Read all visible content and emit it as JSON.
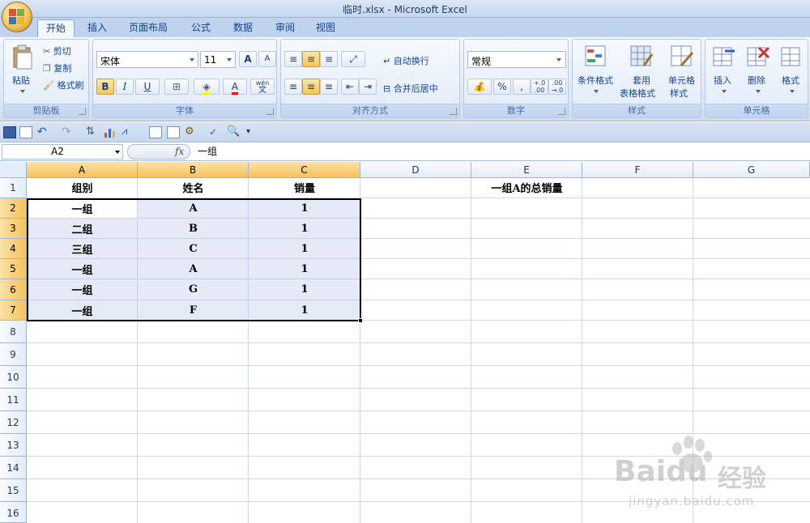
{
  "window": {
    "title": "临时.xlsx - Microsoft Excel"
  },
  "tabs": [
    {
      "label": "开始",
      "active": true
    },
    {
      "label": "插入"
    },
    {
      "label": "页面布局"
    },
    {
      "label": "公式"
    },
    {
      "label": "数据"
    },
    {
      "label": "审阅"
    },
    {
      "label": "视图"
    }
  ],
  "ribbon": {
    "clipboard": {
      "label": "剪贴板",
      "paste": "粘贴",
      "cut": "剪切",
      "copy": "复制",
      "format_painter": "格式刷"
    },
    "font": {
      "label": "字体",
      "font_name": "宋体",
      "font_size": "11",
      "bold": "B",
      "italic": "I",
      "underline": "U",
      "wen": "wén",
      "wen2": "文",
      "grow": "A",
      "shrink": "A"
    },
    "alignment": {
      "label": "对齐方式",
      "wrap_text": "自动换行",
      "merge_center": "合并后居中"
    },
    "number": {
      "label": "数字",
      "format": "常规",
      "percent": "%",
      "comma": ",",
      "inc_decimal": "+.0\n.00",
      "dec_decimal": ".00\n→.0"
    },
    "styles": {
      "label": "样式",
      "conditional": "条件格式",
      "table_format_1": "套用",
      "table_format_2": "表格格式",
      "cell_styles_1": "单元格",
      "cell_styles_2": "样式"
    },
    "cells": {
      "label": "单元格",
      "insert": "插入",
      "delete": "删除",
      "format": "格式"
    }
  },
  "formula_bar": {
    "name_box": "A2",
    "fx": "fx",
    "value": "一组"
  },
  "sheet": {
    "columns": [
      "A",
      "B",
      "C",
      "D",
      "E",
      "F",
      "G"
    ],
    "rows": [
      "1",
      "2",
      "3",
      "4",
      "5",
      "6",
      "7",
      "8",
      "9",
      "10",
      "11",
      "12",
      "13",
      "14",
      "15",
      "16"
    ],
    "cells": {
      "A1": "组别",
      "B1": "姓名",
      "C1": "销量",
      "E1": "一组A的总销量",
      "A2": "一组",
      "B2": "A",
      "C2": "1",
      "A3": "二组",
      "B3": "B",
      "C3": "1",
      "A4": "三组",
      "B4": "C",
      "C4": "1",
      "A5": "一组",
      "B5": "A",
      "C5": "1",
      "A6": "一组",
      "B6": "G",
      "C6": "1",
      "A7": "一组",
      "B7": "F",
      "C7": "1"
    }
  },
  "watermark": {
    "brand": "Baidu",
    "brand_cn": "经验",
    "url": "jingyan.baidu.com"
  }
}
